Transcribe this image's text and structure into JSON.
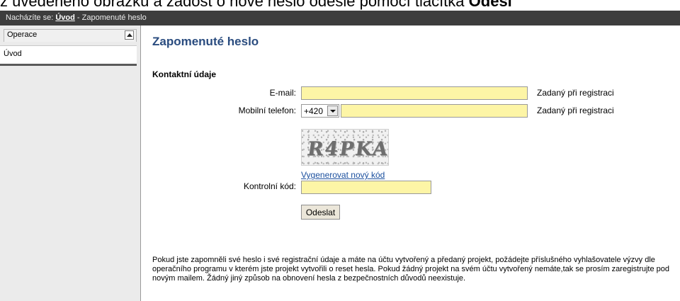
{
  "caption": {
    "text": "z uvedeného obrázku a žádost o nové heslo odešle pomocí tlačítka ",
    "bold": "Odesl"
  },
  "breadcrumb": {
    "prefix": "Nacházíte se:",
    "home_link": "Úvod",
    "separator": "-",
    "current": "Zapomenuté heslo"
  },
  "sidebar": {
    "section_label": "Operace",
    "items": [
      {
        "label": "Úvod"
      }
    ]
  },
  "main": {
    "title": "Zapomenuté heslo",
    "section_title": "Kontaktní údaje",
    "email": {
      "label": "E-mail:",
      "value": "",
      "hint": "Zadaný při registraci"
    },
    "phone": {
      "label": "Mobilní telefon:",
      "prefix": "+420",
      "value": "",
      "hint": "Zadaný při registraci"
    },
    "captcha": {
      "code": "R4PKA",
      "regenerate_label": "Vygenerovat nový kód",
      "label": "Kontrolní kód:",
      "value": ""
    },
    "submit_label": "Odeslat",
    "info_text": "Pokud jste zapomněli své heslo i své registrační údaje a máte na účtu vytvořený a předaný projekt, požádejte příslušného vyhlašovatele výzvy dle operačního programu v kterém jste projekt vytvořili o reset hesla. Pokud žádný projekt na svém účtu vytvořený nemáte,tak se prosím zaregistrujte pod novým mailem. Žádný jiný způsob na obnovení hesla z bezpečnostních důvodů neexistuje."
  },
  "colors": {
    "input_bg": "#fdf5a6",
    "title": "#2a4c7f",
    "breadcrumb_bg": "#3d3d3d",
    "link": "#1a4f9e"
  },
  "icons": [
    "chevron-up-icon",
    "dropdown-arrow-icon"
  ]
}
